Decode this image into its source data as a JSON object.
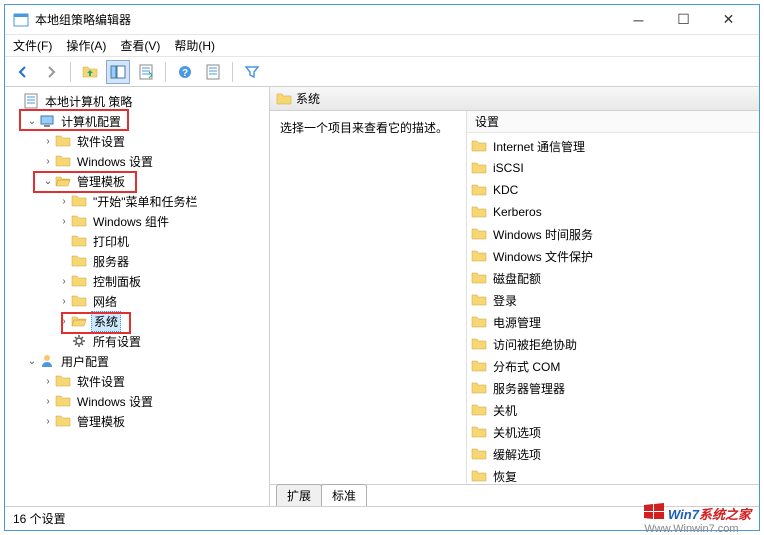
{
  "title": "本地组策略编辑器",
  "menus": [
    "文件(F)",
    "操作(A)",
    "查看(V)",
    "帮助(H)"
  ],
  "tree": {
    "root": "本地计算机 策略",
    "computer_config": "计算机配置",
    "software_settings": "软件设置",
    "windows_settings": "Windows 设置",
    "admin_templates": "管理模板",
    "start_taskbar": "\"开始\"菜单和任务栏",
    "windows_components": "Windows 组件",
    "printers": "打印机",
    "server": "服务器",
    "control_panel": "控制面板",
    "network": "网络",
    "system": "系统",
    "all_settings": "所有设置",
    "user_config": "用户配置",
    "u_software_settings": "软件设置",
    "u_windows_settings": "Windows 设置",
    "u_admin_templates": "管理模板"
  },
  "header": {
    "title": "系统"
  },
  "description": "选择一个项目来查看它的描述。",
  "list_header": "设置",
  "list_items": [
    "Internet 通信管理",
    "iSCSI",
    "KDC",
    "Kerberos",
    "Windows 时间服务",
    "Windows 文件保护",
    "磁盘配额",
    "登录",
    "电源管理",
    "访问被拒绝协助",
    "分布式 COM",
    "服务器管理器",
    "关机",
    "关机选项",
    "缓解选项",
    "恢复"
  ],
  "tabs": {
    "extended": "扩展",
    "standard": "标准"
  },
  "status": "16 个设置",
  "watermark": {
    "brand1": "Win7",
    "brand2": "系统之家",
    "url": "Www.Winwin7.com"
  }
}
